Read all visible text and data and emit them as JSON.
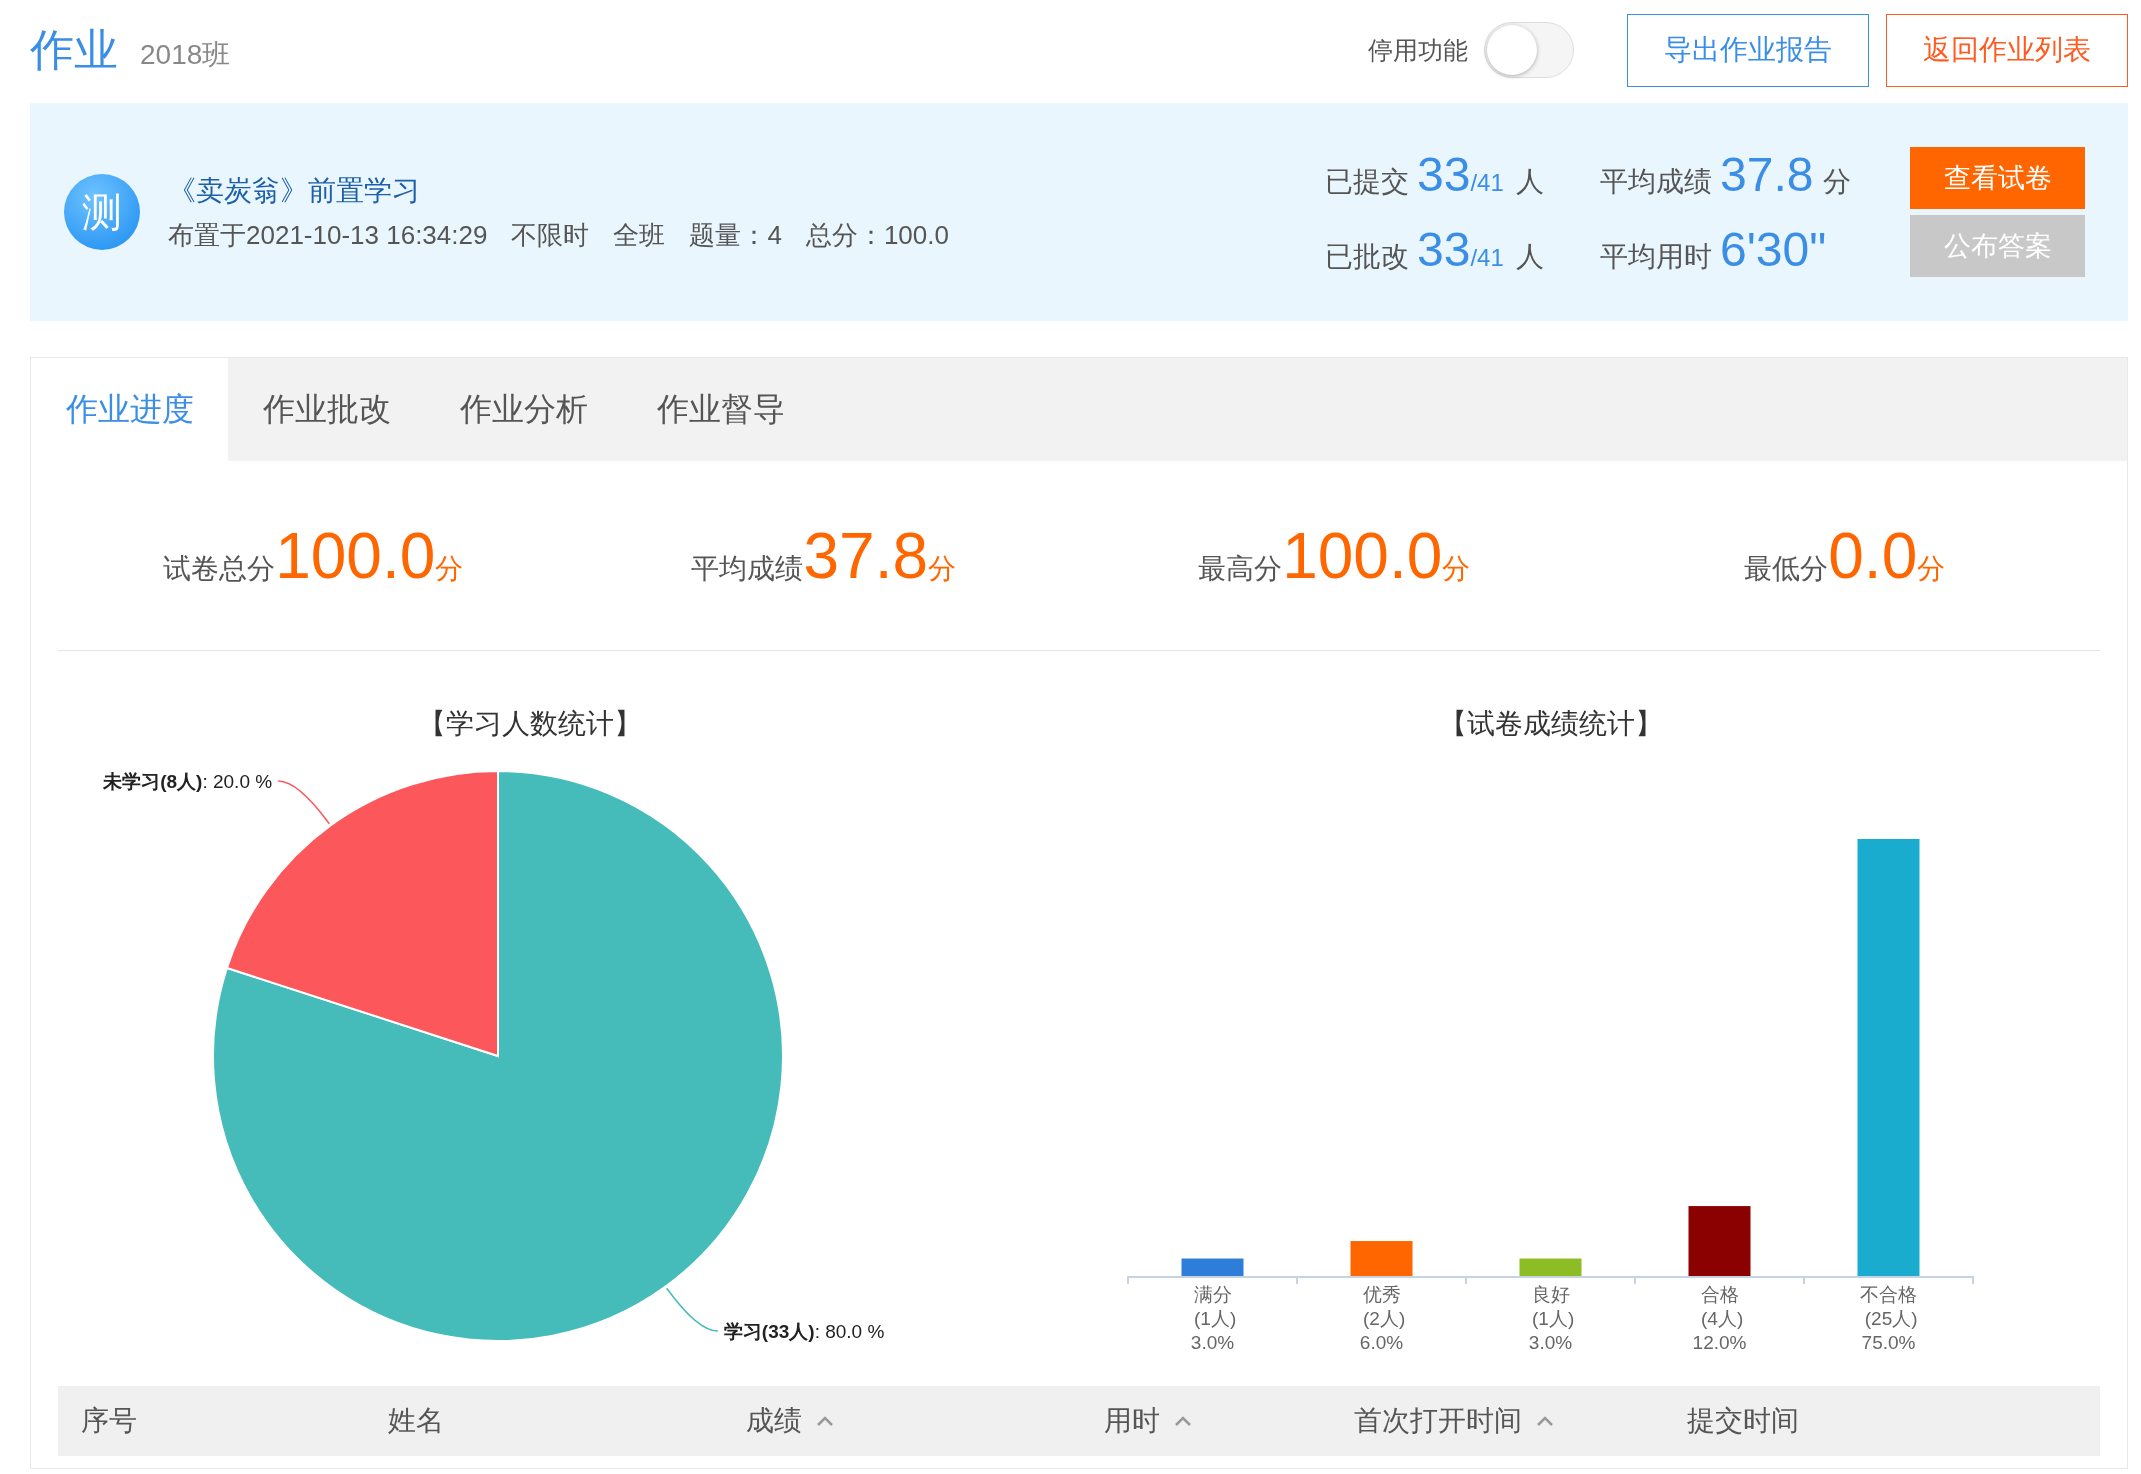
{
  "header": {
    "title": "作业",
    "class_name": "2018班",
    "toggle": {
      "label": "停用功能",
      "on": false
    },
    "buttons": [
      {
        "label": "导出作业报告",
        "kind": "outline-blue"
      },
      {
        "label": "返回作业列表",
        "kind": "outline-orange"
      }
    ]
  },
  "assignment": {
    "icon_text": "测",
    "title": "《卖炭翁》前置学习",
    "meta": [
      "布置于2021-10-13 16:34:29",
      "不限时",
      "全班",
      "题量：4",
      "总分：100.0"
    ],
    "stats": [
      {
        "label": "已提交",
        "value": "33",
        "total": "/41",
        "unit": "人"
      },
      {
        "label": "平均成绩",
        "value": "37.8",
        "unit": "分"
      },
      {
        "label": "已批改",
        "value": "33",
        "total": "/41",
        "unit": "人"
      },
      {
        "label": "平均用时",
        "value": "6'30\""
      }
    ],
    "buttons": [
      {
        "label": "查看试卷",
        "disabled": false
      },
      {
        "label": "公布答案",
        "disabled": true
      }
    ]
  },
  "tabs": [
    {
      "label": "作业进度",
      "selected": true
    },
    {
      "label": "作业批改",
      "selected": false
    },
    {
      "label": "作业分析",
      "selected": false
    },
    {
      "label": "作业督导",
      "selected": false
    }
  ],
  "summary": [
    {
      "label": "试卷总分",
      "value": "100.0",
      "unit": "分"
    },
    {
      "label": "平均成绩",
      "value": "37.8",
      "unit": "分"
    },
    {
      "label": "最高分",
      "value": "100.0",
      "unit": "分"
    },
    {
      "label": "最低分",
      "value": "0.0",
      "unit": "分"
    }
  ],
  "pie_panel": {
    "chart_data": {
      "type": "pie",
      "title": "【学习人数统计】",
      "categories": [
        "学习(33人)",
        "未学习(8人)"
      ],
      "values": [
        80,
        20
      ],
      "value_labels": [
        ": 80.0 %",
        ": 20.0 %"
      ],
      "colors": [
        "#45bbba",
        "#fc585c"
      ]
    }
  },
  "bar_panel": {
    "chart_data": {
      "type": "bar",
      "title": "【试卷成绩统计】",
      "categories": [
        "满分 (1人)",
        "优秀 (2人)",
        "良好 (1人)",
        "合格 (4人)",
        "不合格 (25人)"
      ],
      "values": [
        3,
        6,
        3,
        12,
        75
      ],
      "value_labels": [
        "3.0%",
        "6.0%",
        "3.0%",
        "12.0%",
        "75.0%"
      ],
      "colors": [
        "#2e7ed9",
        "#ff6600",
        "#8dbd24",
        "#8b0000",
        "#1aaccf"
      ]
    }
  },
  "table": {
    "columns": [
      {
        "label": "序号",
        "sortable": false
      },
      {
        "label": "姓名",
        "sortable": false
      },
      {
        "label": "成绩",
        "sortable": true
      },
      {
        "label": "用时",
        "sortable": true
      },
      {
        "label": "首次打开时间",
        "sortable": true
      },
      {
        "label": "提交时间",
        "sortable": false
      }
    ]
  }
}
